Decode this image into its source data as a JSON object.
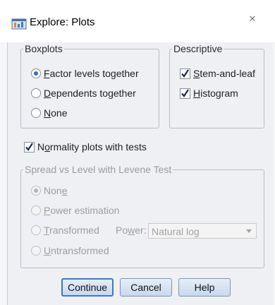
{
  "window": {
    "title": "Explore: Plots",
    "close_symbol": "✕",
    "icon": "spss-window-icon"
  },
  "boxplots": {
    "legend": "Boxplots",
    "options": [
      {
        "pre": "",
        "u": "F",
        "post": "actor levels together",
        "checked": true
      },
      {
        "pre": "",
        "u": "D",
        "post": "ependents together",
        "checked": false
      },
      {
        "pre": "",
        "u": "N",
        "post": "one",
        "checked": false
      }
    ]
  },
  "descriptive": {
    "legend": "Descriptive",
    "options": [
      {
        "pre": "",
        "u": "S",
        "post": "tem-and-leaf",
        "checked": true
      },
      {
        "pre": "",
        "u": "H",
        "post": "istogram",
        "checked": true
      }
    ]
  },
  "normality": {
    "pre": "N",
    "u": "o",
    "post": "rmality plots with tests",
    "checked": true
  },
  "spread": {
    "legend": "Spread vs Level with Levene Test",
    "options": [
      {
        "pre": "Non",
        "u": "e",
        "post": "",
        "checked": true
      },
      {
        "pre": "",
        "u": "P",
        "post": "ower estimation",
        "checked": false
      },
      {
        "pre": "",
        "u": "T",
        "post": "ransformed",
        "checked": false
      },
      {
        "pre": "",
        "u": "U",
        "post": "ntransformed",
        "checked": false
      }
    ],
    "power_label_pre": "Po",
    "power_label_u": "w",
    "power_label_post": "er:",
    "power_value": "Natural log"
  },
  "buttons": {
    "continue": "Continue",
    "cancel": "Cancel",
    "help": "Help"
  },
  "colors": {
    "accent": "#2c6fc7",
    "button_border": "#7f93b5",
    "default_button_border": "#3a78d0"
  }
}
